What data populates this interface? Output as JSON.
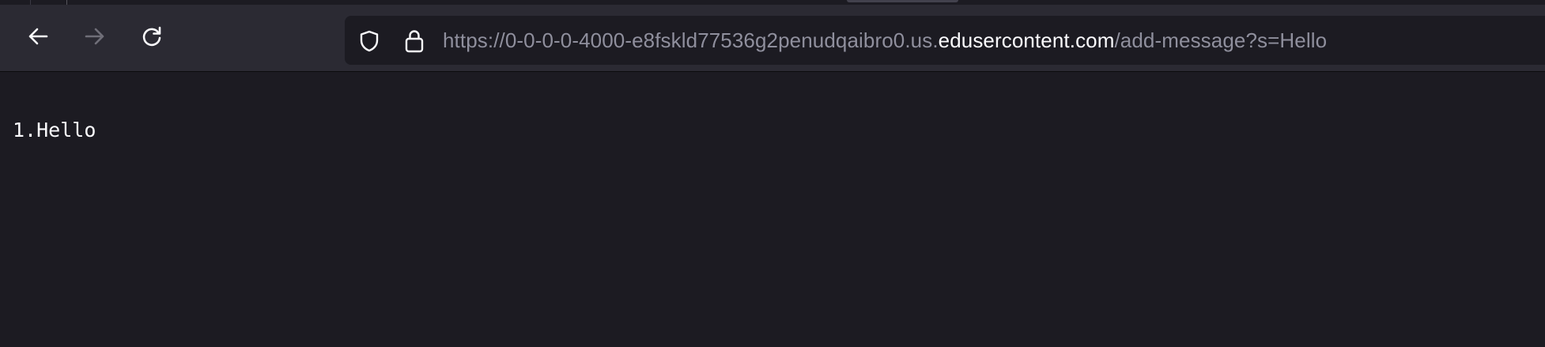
{
  "browser": {
    "toolbar": {
      "back_icon": "arrow-left-icon",
      "forward_icon": "arrow-right-icon",
      "reload_icon": "reload-icon",
      "forward_enabled": false
    },
    "urlbar": {
      "tracking_icon": "shield-icon",
      "security_icon": "lock-icon",
      "url_prefix": "https://0-0-0-0-4000-e8fskld77536g2penudqaibro0.us.",
      "url_domain": "edusercontent.com",
      "url_path": "/add-message?s=Hello"
    }
  },
  "page": {
    "messages": [
      {
        "number": "1.",
        "text": "Hello"
      }
    ]
  },
  "colors": {
    "toolbar_bg": "#2b2a33",
    "page_bg": "#1c1b22",
    "text_primary": "#fbfbfe",
    "text_muted": "#8f8f9d",
    "icon_disabled": "#6f6e78"
  }
}
